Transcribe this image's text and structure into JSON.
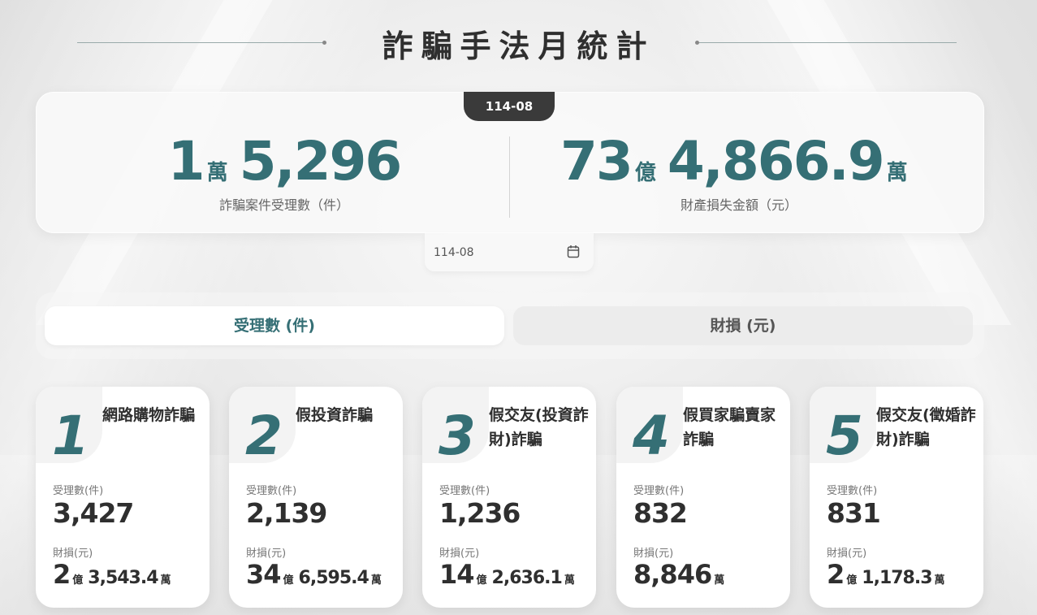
{
  "page": {
    "title": "詐騙手法月統計"
  },
  "summary": {
    "period": "114-08",
    "cases": {
      "major": "1",
      "major_unit": "萬",
      "minor": "5,296",
      "label": "詐騙案件受理數（件）"
    },
    "loss": {
      "major": "73",
      "major_unit": "億",
      "minor": "4,866.9",
      "minor_unit": "萬",
      "label": "財產損失金額（元）"
    }
  },
  "date_picker": {
    "value": "114-08",
    "icon": "calendar-icon"
  },
  "tabs": [
    {
      "label": "受理數 (件)",
      "active": true
    },
    {
      "label": "財損 (元)",
      "active": false
    }
  ],
  "cards": [
    {
      "rank": "1",
      "name": "網路購物詐騙",
      "count_label": "受理數(件)",
      "count": "3,427",
      "loss_label": "財損(元)",
      "loss_a": "2",
      "loss_a_unit": "億",
      "loss_b": "3,543.4",
      "loss_b_unit": "萬"
    },
    {
      "rank": "2",
      "name": "假投資詐騙",
      "count_label": "受理數(件)",
      "count": "2,139",
      "loss_label": "財損(元)",
      "loss_a": "34",
      "loss_a_unit": "億",
      "loss_b": "6,595.4",
      "loss_b_unit": "萬"
    },
    {
      "rank": "3",
      "name": "假交友(投資詐財)詐騙",
      "count_label": "受理數(件)",
      "count": "1,236",
      "loss_label": "財損(元)",
      "loss_a": "14",
      "loss_a_unit": "億",
      "loss_b": "2,636.1",
      "loss_b_unit": "萬"
    },
    {
      "rank": "4",
      "name": "假買家騙賣家詐騙",
      "count_label": "受理數(件)",
      "count": "832",
      "loss_label": "財損(元)",
      "loss_a": "8,846",
      "loss_a_unit": "萬",
      "loss_b": "",
      "loss_b_unit": ""
    },
    {
      "rank": "5",
      "name": "假交友(徵婚詐財)詐騙",
      "count_label": "受理數(件)",
      "count": "831",
      "loss_label": "財損(元)",
      "loss_a": "2",
      "loss_a_unit": "億",
      "loss_b": "1,178.3",
      "loss_b_unit": "萬"
    }
  ],
  "colors": {
    "accent": "#356f75",
    "dark": "#3a3a3a"
  }
}
